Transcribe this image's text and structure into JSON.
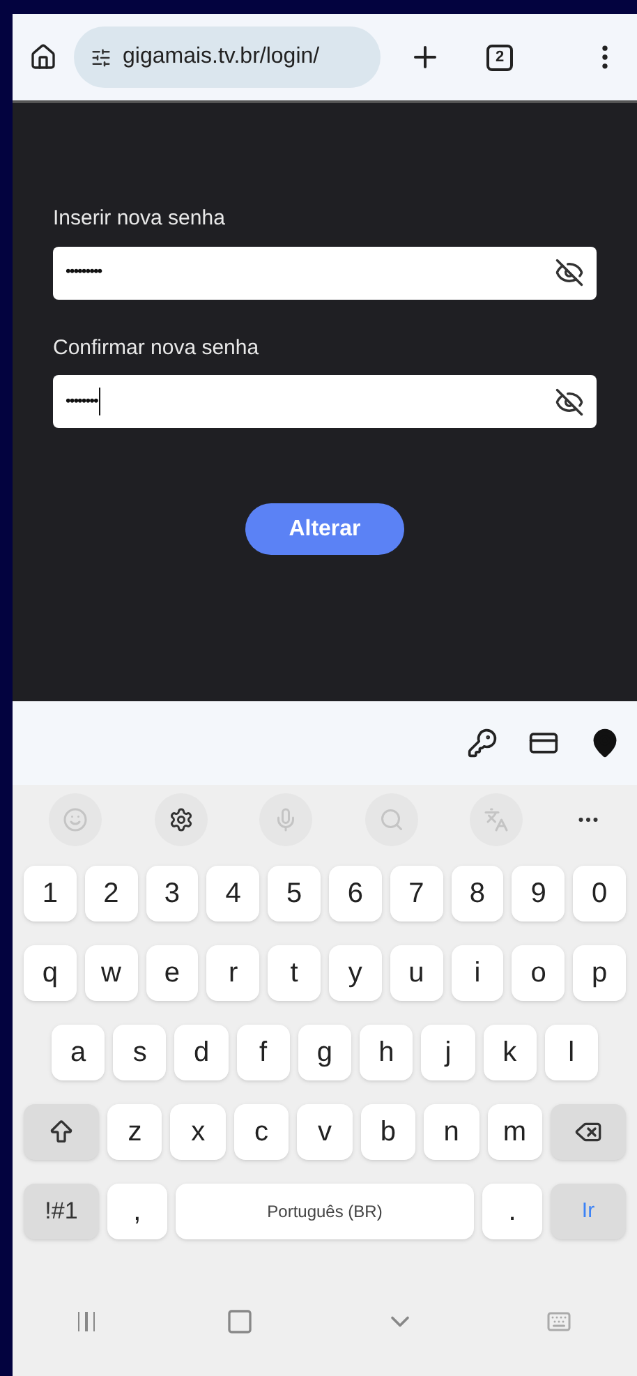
{
  "browser": {
    "url": "gigamais.tv.br/login/",
    "tab_count": "2"
  },
  "form": {
    "fields": [
      {
        "label": "Inserir nova senha",
        "value": "•••••••••",
        "focused": false
      },
      {
        "label": "Confirmar nova senha",
        "value": "••••••••",
        "focused": true
      }
    ],
    "button": "Alterar"
  },
  "keyboard": {
    "rows": [
      {
        "keys": [
          {
            "kind": "char",
            "label": "1"
          },
          {
            "kind": "char",
            "label": "2"
          },
          {
            "kind": "char",
            "label": "3"
          },
          {
            "kind": "char",
            "label": "4"
          },
          {
            "kind": "char",
            "label": "5"
          },
          {
            "kind": "char",
            "label": "6"
          },
          {
            "kind": "char",
            "label": "7"
          },
          {
            "kind": "char",
            "label": "8"
          },
          {
            "kind": "char",
            "label": "9"
          },
          {
            "kind": "char",
            "label": "0"
          }
        ]
      },
      {
        "keys": [
          {
            "kind": "char",
            "label": "q"
          },
          {
            "kind": "char",
            "label": "w"
          },
          {
            "kind": "char",
            "label": "e"
          },
          {
            "kind": "char",
            "label": "r"
          },
          {
            "kind": "char",
            "label": "t"
          },
          {
            "kind": "char",
            "label": "y"
          },
          {
            "kind": "char",
            "label": "u"
          },
          {
            "kind": "char",
            "label": "i"
          },
          {
            "kind": "char",
            "label": "o"
          },
          {
            "kind": "char",
            "label": "p"
          }
        ]
      },
      {
        "keys": [
          {
            "kind": "char",
            "label": "a"
          },
          {
            "kind": "char",
            "label": "s"
          },
          {
            "kind": "char",
            "label": "d"
          },
          {
            "kind": "char",
            "label": "f"
          },
          {
            "kind": "char",
            "label": "g"
          },
          {
            "kind": "char",
            "label": "h"
          },
          {
            "kind": "char",
            "label": "j"
          },
          {
            "kind": "char",
            "label": "k"
          },
          {
            "kind": "char",
            "label": "l"
          }
        ]
      },
      {
        "keys": [
          {
            "kind": "shift"
          },
          {
            "kind": "char",
            "label": "z"
          },
          {
            "kind": "char",
            "label": "x"
          },
          {
            "kind": "char",
            "label": "c"
          },
          {
            "kind": "char",
            "label": "v"
          },
          {
            "kind": "char",
            "label": "b"
          },
          {
            "kind": "char",
            "label": "n"
          },
          {
            "kind": "char",
            "label": "m"
          },
          {
            "kind": "backspace"
          }
        ]
      },
      {
        "keys": [
          {
            "kind": "symbols",
            "label": "!#1"
          },
          {
            "kind": "char",
            "label": ","
          },
          {
            "kind": "space",
            "label": "Português (BR)"
          },
          {
            "kind": "char",
            "label": "."
          },
          {
            "kind": "go",
            "label": "Ir"
          }
        ]
      }
    ]
  }
}
